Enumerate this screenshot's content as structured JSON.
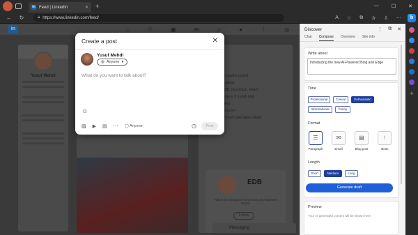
{
  "browser": {
    "tab_title": "Feed | LinkedIn",
    "tab_favicon": "in",
    "url": "https://www.linkedin.com/feed/",
    "new_tab": "+",
    "window_controls": [
      "—",
      "☐",
      "✕"
    ]
  },
  "linkedin": {
    "profile_name": "Yusuf Mehdi",
    "news_items": [
      "...ls by quarter pound",
      "...pplications",
      "...ffs, BID, DoorDash, Match",
      "...y surge to 5 month high",
      "...Trading",
      "...Recession?",
      "...ovemment plan takes shape"
    ],
    "ad_brand": "EDB",
    "ad_text": "Follow the Singapore Economic Development Board",
    "ad_follow": "Follow",
    "messaging": "Messaging"
  },
  "modal": {
    "title": "Create a post",
    "close": "✕",
    "user_name": "Yusuf Mehdi",
    "audience": "Anyone",
    "placeholder": "What do you want to talk about?",
    "toolbar_anyone": "Anyone",
    "post_button": "Post"
  },
  "discover": {
    "title": "Discover",
    "tabs": [
      "Chat",
      "Compose",
      "Overview",
      "Site info"
    ],
    "active_tab": "Compose",
    "write_about_label": "Write about",
    "write_about_value": "Introducing the new AI-Powered Bing and Edge",
    "tone_label": "Tone",
    "tones": [
      "Professional",
      "Casual",
      "Enthusiastic",
      "Informational",
      "Funny"
    ],
    "selected_tone": "Enthusiastic",
    "format_label": "Format",
    "formats": [
      "Paragraph",
      "Email",
      "Blog post",
      "Ideas"
    ],
    "selected_format": "Paragraph",
    "length_label": "Length",
    "lengths": [
      "Short",
      "Medium",
      "Long"
    ],
    "selected_length": "Medium",
    "generate_button": "Generate draft",
    "preview_label": "Preview",
    "preview_placeholder": "Your AI generated content will be shown here"
  },
  "colors": {
    "accent": "#1f5fd9",
    "linkedin_blue": "#0a66c2",
    "selected_chip": "#1f3f9f"
  }
}
